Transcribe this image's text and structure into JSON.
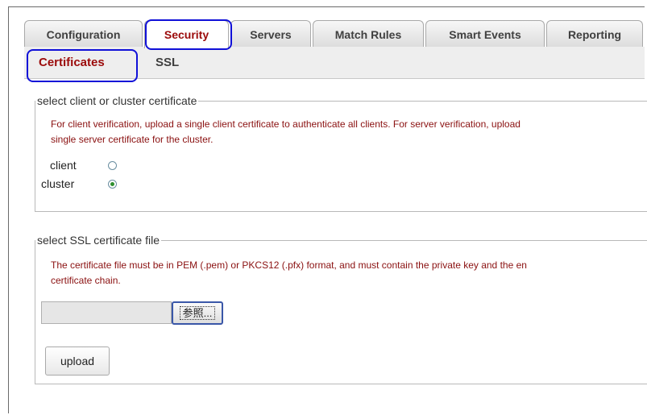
{
  "tabs": [
    {
      "label": "Configuration",
      "active": false
    },
    {
      "label": "Security",
      "active": true
    },
    {
      "label": "Servers",
      "active": false
    },
    {
      "label": "Match Rules",
      "active": false
    },
    {
      "label": "Smart Events",
      "active": false
    },
    {
      "label": "Reporting",
      "active": false
    }
  ],
  "subtabs": [
    {
      "label": "Certificates",
      "active": true
    },
    {
      "label": "SSL",
      "active": false
    }
  ],
  "client_section": {
    "legend": "select client or cluster certificate",
    "description_line1": "For client verification, upload a single client certificate to authenticate all clients. For server verification, upload",
    "description_line2": "single server certificate for the cluster.",
    "options": [
      {
        "label": "client",
        "checked": false
      },
      {
        "label": "cluster",
        "checked": true
      }
    ]
  },
  "ssl_section": {
    "legend": "select SSL certificate file",
    "description_line1": "The certificate file must be in PEM (.pem) or PKCS12 (.pfx) format, and must contain the private key and the en",
    "description_line2": "certificate chain.",
    "file_value": "",
    "browse_label": "参照...",
    "upload_label": "upload"
  },
  "colors": {
    "active_tab_text": "#9b0a0a",
    "highlight": "#1010d8",
    "description_text": "#8a1010",
    "radio_checked": "#2f8f2f"
  }
}
